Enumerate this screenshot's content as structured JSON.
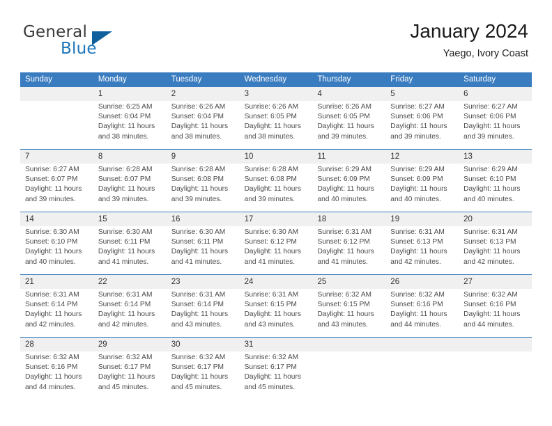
{
  "brand": {
    "name_top": "General",
    "name_bottom": "Blue",
    "color_primary": "#1b75bb",
    "color_triangle": "#10609e"
  },
  "header": {
    "title": "January 2024",
    "subtitle": "Yaego, Ivory Coast"
  },
  "calendar": {
    "header_bg": "#3a7cc0",
    "daynum_bg": "#f0f0f0",
    "weekdays": [
      "Sunday",
      "Monday",
      "Tuesday",
      "Wednesday",
      "Thursday",
      "Friday",
      "Saturday"
    ],
    "weeks": [
      [
        {
          "day": "",
          "lines": []
        },
        {
          "day": "1",
          "lines": [
            "Sunrise: 6:25 AM",
            "Sunset: 6:04 PM",
            "Daylight: 11 hours",
            "and 38 minutes."
          ]
        },
        {
          "day": "2",
          "lines": [
            "Sunrise: 6:26 AM",
            "Sunset: 6:04 PM",
            "Daylight: 11 hours",
            "and 38 minutes."
          ]
        },
        {
          "day": "3",
          "lines": [
            "Sunrise: 6:26 AM",
            "Sunset: 6:05 PM",
            "Daylight: 11 hours",
            "and 38 minutes."
          ]
        },
        {
          "day": "4",
          "lines": [
            "Sunrise: 6:26 AM",
            "Sunset: 6:05 PM",
            "Daylight: 11 hours",
            "and 39 minutes."
          ]
        },
        {
          "day": "5",
          "lines": [
            "Sunrise: 6:27 AM",
            "Sunset: 6:06 PM",
            "Daylight: 11 hours",
            "and 39 minutes."
          ]
        },
        {
          "day": "6",
          "lines": [
            "Sunrise: 6:27 AM",
            "Sunset: 6:06 PM",
            "Daylight: 11 hours",
            "and 39 minutes."
          ]
        }
      ],
      [
        {
          "day": "7",
          "lines": [
            "Sunrise: 6:27 AM",
            "Sunset: 6:07 PM",
            "Daylight: 11 hours",
            "and 39 minutes."
          ]
        },
        {
          "day": "8",
          "lines": [
            "Sunrise: 6:28 AM",
            "Sunset: 6:07 PM",
            "Daylight: 11 hours",
            "and 39 minutes."
          ]
        },
        {
          "day": "9",
          "lines": [
            "Sunrise: 6:28 AM",
            "Sunset: 6:08 PM",
            "Daylight: 11 hours",
            "and 39 minutes."
          ]
        },
        {
          "day": "10",
          "lines": [
            "Sunrise: 6:28 AM",
            "Sunset: 6:08 PM",
            "Daylight: 11 hours",
            "and 39 minutes."
          ]
        },
        {
          "day": "11",
          "lines": [
            "Sunrise: 6:29 AM",
            "Sunset: 6:09 PM",
            "Daylight: 11 hours",
            "and 40 minutes."
          ]
        },
        {
          "day": "12",
          "lines": [
            "Sunrise: 6:29 AM",
            "Sunset: 6:09 PM",
            "Daylight: 11 hours",
            "and 40 minutes."
          ]
        },
        {
          "day": "13",
          "lines": [
            "Sunrise: 6:29 AM",
            "Sunset: 6:10 PM",
            "Daylight: 11 hours",
            "and 40 minutes."
          ]
        }
      ],
      [
        {
          "day": "14",
          "lines": [
            "Sunrise: 6:30 AM",
            "Sunset: 6:10 PM",
            "Daylight: 11 hours",
            "and 40 minutes."
          ]
        },
        {
          "day": "15",
          "lines": [
            "Sunrise: 6:30 AM",
            "Sunset: 6:11 PM",
            "Daylight: 11 hours",
            "and 41 minutes."
          ]
        },
        {
          "day": "16",
          "lines": [
            "Sunrise: 6:30 AM",
            "Sunset: 6:11 PM",
            "Daylight: 11 hours",
            "and 41 minutes."
          ]
        },
        {
          "day": "17",
          "lines": [
            "Sunrise: 6:30 AM",
            "Sunset: 6:12 PM",
            "Daylight: 11 hours",
            "and 41 minutes."
          ]
        },
        {
          "day": "18",
          "lines": [
            "Sunrise: 6:31 AM",
            "Sunset: 6:12 PM",
            "Daylight: 11 hours",
            "and 41 minutes."
          ]
        },
        {
          "day": "19",
          "lines": [
            "Sunrise: 6:31 AM",
            "Sunset: 6:13 PM",
            "Daylight: 11 hours",
            "and 42 minutes."
          ]
        },
        {
          "day": "20",
          "lines": [
            "Sunrise: 6:31 AM",
            "Sunset: 6:13 PM",
            "Daylight: 11 hours",
            "and 42 minutes."
          ]
        }
      ],
      [
        {
          "day": "21",
          "lines": [
            "Sunrise: 6:31 AM",
            "Sunset: 6:14 PM",
            "Daylight: 11 hours",
            "and 42 minutes."
          ]
        },
        {
          "day": "22",
          "lines": [
            "Sunrise: 6:31 AM",
            "Sunset: 6:14 PM",
            "Daylight: 11 hours",
            "and 42 minutes."
          ]
        },
        {
          "day": "23",
          "lines": [
            "Sunrise: 6:31 AM",
            "Sunset: 6:14 PM",
            "Daylight: 11 hours",
            "and 43 minutes."
          ]
        },
        {
          "day": "24",
          "lines": [
            "Sunrise: 6:31 AM",
            "Sunset: 6:15 PM",
            "Daylight: 11 hours",
            "and 43 minutes."
          ]
        },
        {
          "day": "25",
          "lines": [
            "Sunrise: 6:32 AM",
            "Sunset: 6:15 PM",
            "Daylight: 11 hours",
            "and 43 minutes."
          ]
        },
        {
          "day": "26",
          "lines": [
            "Sunrise: 6:32 AM",
            "Sunset: 6:16 PM",
            "Daylight: 11 hours",
            "and 44 minutes."
          ]
        },
        {
          "day": "27",
          "lines": [
            "Sunrise: 6:32 AM",
            "Sunset: 6:16 PM",
            "Daylight: 11 hours",
            "and 44 minutes."
          ]
        }
      ],
      [
        {
          "day": "28",
          "lines": [
            "Sunrise: 6:32 AM",
            "Sunset: 6:16 PM",
            "Daylight: 11 hours",
            "and 44 minutes."
          ]
        },
        {
          "day": "29",
          "lines": [
            "Sunrise: 6:32 AM",
            "Sunset: 6:17 PM",
            "Daylight: 11 hours",
            "and 45 minutes."
          ]
        },
        {
          "day": "30",
          "lines": [
            "Sunrise: 6:32 AM",
            "Sunset: 6:17 PM",
            "Daylight: 11 hours",
            "and 45 minutes."
          ]
        },
        {
          "day": "31",
          "lines": [
            "Sunrise: 6:32 AM",
            "Sunset: 6:17 PM",
            "Daylight: 11 hours",
            "and 45 minutes."
          ]
        },
        {
          "day": "",
          "lines": []
        },
        {
          "day": "",
          "lines": []
        },
        {
          "day": "",
          "lines": []
        }
      ]
    ]
  }
}
